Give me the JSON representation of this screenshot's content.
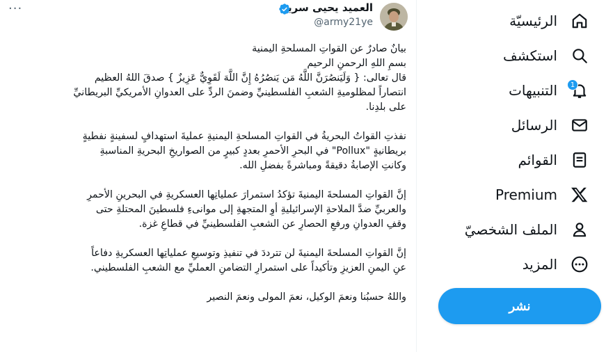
{
  "nav": {
    "items": [
      {
        "label": "الرئيسيّة",
        "icon": "home-icon"
      },
      {
        "label": "استكشف",
        "icon": "search-icon"
      },
      {
        "label": "التنبيهات",
        "icon": "bell-icon",
        "badge": "1"
      },
      {
        "label": "الرسائل",
        "icon": "mail-icon"
      },
      {
        "label": "القوائم",
        "icon": "list-icon"
      },
      {
        "label": "Premium",
        "icon": "x-logo-icon"
      },
      {
        "label": "الملف الشخصيّ",
        "icon": "profile-icon"
      },
      {
        "label": "المزيد",
        "icon": "more-circle-icon"
      }
    ],
    "post_label": "نشر"
  },
  "tweet": {
    "author_name": "العميد يحيى سريع",
    "handle": "@army21ye",
    "more": "···",
    "paragraphs": [
      [
        "بيانٌ صادرٌ عن القواتِ المسلحةِ اليمنية",
        "بسمِ اللهِ الرحمنِ الرحيم",
        "قال تعالى: { وَلَيَنصُرَنَّ اللَّهُ مَن يَنصُرُهُ إِنَّ اللَّهَ لَقَوِيٌّ عَزِيزٌ } صدقَ اللهُ العظيم",
        "انتصاراً لمظلوميةِ الشعبِ الفلسطينيِّ وضمنَ الردِّ على العدوانِ الأمريكيِّ البريطانيِّ",
        "على بلدِنا."
      ],
      [
        "نفذتِ القواتُ البحريةُ في القواتِ المسلحةِ اليمنيةِ عمليةَ استهدافٍ لسفينةٍ نفطيةٍ",
        "بريطانيةٍ \"Pollux\"     في البحرِ الأحمرِ بعددٍ كبيرٍ من الصواريخِ البحريةِ المناسبةِ",
        "وكانتِ الإصابةُ دقيقةً ومباشرةً بفضلِ الله."
      ],
      [
        "إنَّ القواتِ المسلحةَ اليمنيةَ تؤكدُ استمرارَ عملياتِها العسكريةِ في البحرينِ الأحمرِ",
        "والعربيِّ ضدَّ الملاحةِ الإسرائيليةِ أوِ المتجهةِ إلى موانىءِ فلسطينَ المحتلةِ حتى",
        "وقفِ العدوانِ ورفعِ الحصارِ عن الشعبِ الفلسطينيِّ في قطاعِ غزة."
      ],
      [
        "إنَّ القواتِ المسلحةَ اليمنيةَ لن تترددَ في تنفيذِ وتوسيعِ عملياتِها العسكريةِ دفاعاً",
        "عنِ اليمنِ العزيزِ وتأكيداً على استمرارِ التضامنِ العمليِّ مع الشعبِ الفلسطيني."
      ],
      [
        "واللهُ حسبُنا ونعمَ الوكيل، نعمَ المولى ونعمَ النصير"
      ]
    ]
  },
  "colors": {
    "accent": "#1d9bf0",
    "text": "#0f1419",
    "muted": "#536471"
  }
}
